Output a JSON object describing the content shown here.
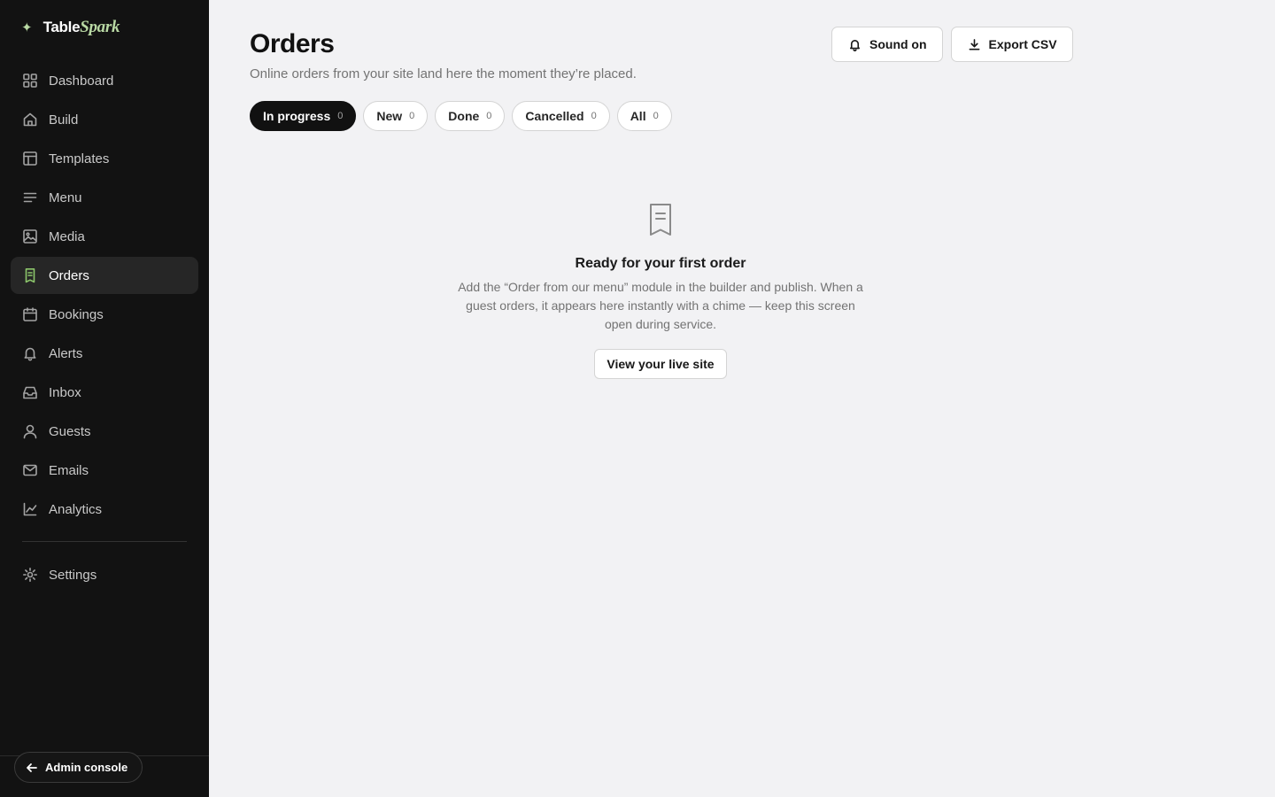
{
  "brand": {
    "spark_icon": "✦",
    "name_part1": "Table",
    "name_part2": "Spark"
  },
  "sidebar": {
    "items": [
      {
        "label": "Dashboard",
        "icon": "grid-icon",
        "active": false
      },
      {
        "label": "Build",
        "icon": "home-icon",
        "active": false
      },
      {
        "label": "Templates",
        "icon": "layout-icon",
        "active": false
      },
      {
        "label": "Menu",
        "icon": "lines-icon",
        "active": false
      },
      {
        "label": "Media",
        "icon": "image-icon",
        "active": false
      },
      {
        "label": "Orders",
        "icon": "receipt-icon",
        "active": true
      },
      {
        "label": "Bookings",
        "icon": "calendar-icon",
        "active": false
      },
      {
        "label": "Alerts",
        "icon": "bell-icon",
        "active": false
      },
      {
        "label": "Inbox",
        "icon": "inbox-icon",
        "active": false
      },
      {
        "label": "Guests",
        "icon": "user-icon",
        "active": false
      },
      {
        "label": "Emails",
        "icon": "mail-icon",
        "active": false
      },
      {
        "label": "Analytics",
        "icon": "chart-icon",
        "active": false
      }
    ],
    "settings": {
      "label": "Settings",
      "icon": "gear-icon"
    },
    "admin_console": "Admin console"
  },
  "header": {
    "title": "Orders",
    "subtitle": "Online orders from your site land here the moment they’re placed.",
    "sound_label": "Sound on",
    "export_label": "Export CSV"
  },
  "tabs": [
    {
      "label": "In progress",
      "count": "0",
      "active": true
    },
    {
      "label": "New",
      "count": "0",
      "active": false
    },
    {
      "label": "Done",
      "count": "0",
      "active": false
    },
    {
      "label": "Cancelled",
      "count": "0",
      "active": false
    },
    {
      "label": "All",
      "count": "0",
      "active": false
    }
  ],
  "empty_state": {
    "title": "Ready for your first order",
    "body": "Add the “Order from our menu” module in the builder and publish. When a guest orders, it appears here instantly with a chime — keep this screen open during service.",
    "button": "View your live site"
  },
  "colors": {
    "sidebar_bg": "#121212",
    "accent": "#8cc56b",
    "page_bg": "#f2f2f4"
  }
}
